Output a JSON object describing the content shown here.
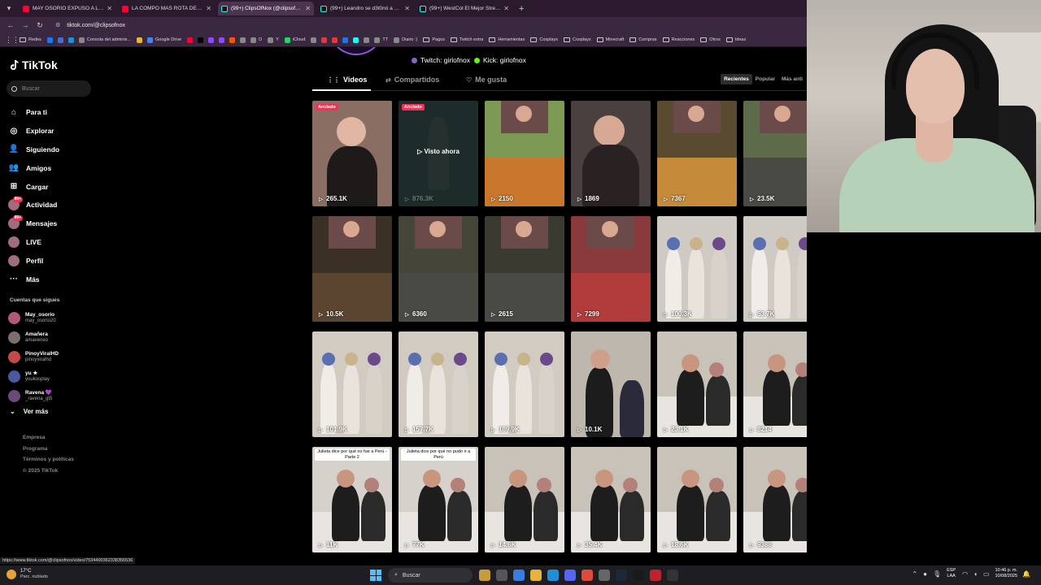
{
  "browser": {
    "tabs": [
      {
        "label": "MAY OSORIO EXPUSO A LEAN",
        "icon": "youtube-icon",
        "active": false
      },
      {
        "label": "LA COMPO MAS ROTA DEL M",
        "icon": "youtube-icon",
        "active": false
      },
      {
        "label": "(99+) ClipsOfNox (@clipsofnox)",
        "icon": "tiktok-icon",
        "active": true
      },
      {
        "label": "(99+) Leandro se d3t0nó a May",
        "icon": "tiktok-icon",
        "active": false
      },
      {
        "label": "(99+) WestCol El Mejor Stream",
        "icon": "tiktok-icon",
        "active": false
      }
    ],
    "url": "tiktok.com/@clipsofnox",
    "bookmarks": [
      "Redes",
      "",
      "",
      "",
      "Consola del adminis...",
      "",
      "Google Drive",
      "",
      "",
      "",
      "",
      "",
      "",
      "D",
      "Y",
      "iCloud",
      "",
      "",
      "",
      "",
      "",
      "",
      "TT",
      "Diario :)",
      "Pagos",
      "Twitch extra",
      "Herramientas",
      "Cosplays",
      "Cosplays",
      "Minecraft",
      "Compras",
      "Reacciones",
      "Otros",
      "Ideas"
    ]
  },
  "sidebar": {
    "logo": "TikTok",
    "search_placeholder": "Buscar",
    "nav": [
      {
        "label": "Para ti",
        "icon": "home-icon"
      },
      {
        "label": "Explorar",
        "icon": "compass-icon"
      },
      {
        "label": "Siguiendo",
        "icon": "following-icon"
      },
      {
        "label": "Amigos",
        "icon": "friends-icon"
      },
      {
        "label": "Cargar",
        "icon": "upload-icon"
      },
      {
        "label": "Actividad",
        "icon": "activity-icon",
        "badge": "99+"
      },
      {
        "label": "Mensajes",
        "icon": "messages-icon",
        "badge": "99+"
      },
      {
        "label": "LIVE",
        "icon": "live-icon"
      },
      {
        "label": "Perfil",
        "icon": "profile-icon"
      },
      {
        "label": "Más",
        "icon": "more-icon"
      }
    ],
    "following_title": "Cuentas que sigues",
    "following": [
      {
        "name": "May_osorio",
        "handle": "may_osorio20",
        "color": "#b05a78"
      },
      {
        "name": "Amañera",
        "handle": "amaveneo",
        "color": "#7a6f6a"
      },
      {
        "name": "PinoyViralHD",
        "handle": "pinoyviralhd",
        "color": "#c24a4a"
      },
      {
        "name": "yu ★",
        "handle": "yuukosplay",
        "color": "#4a5a9a"
      },
      {
        "name": "Ravena 💜",
        "handle": "_ravena_gt5",
        "color": "#6a4a7a"
      }
    ],
    "ver_mas": "Ver más",
    "footer": [
      "Empresa",
      "Programa",
      "Términos y políticas",
      "© 2025 TikTok"
    ]
  },
  "profile": {
    "twitch": "Twitch: girlofnox",
    "kick": "Kick: girlofnox",
    "tabs": [
      "Videos",
      "Compartidos",
      "Me gusta"
    ],
    "sort": [
      "Recientes",
      "Popular",
      "Más anti"
    ]
  },
  "videos": [
    {
      "views": "265.1K",
      "pinned": "Anclado",
      "bg": "#8a6e63",
      "theme": "girl"
    },
    {
      "views": "876.3K",
      "pinned": "Anclado",
      "bg": "#1d2b2a",
      "theme": "dark",
      "overlay": "Visto ahora"
    },
    {
      "views": "2150",
      "bg": "#7d9a55",
      "theme": "mc-orange"
    },
    {
      "views": "1869",
      "bg": "#4a4040",
      "theme": "girl-dark"
    },
    {
      "views": "7367",
      "bg": "#5a4a2f",
      "theme": "mc-fire"
    },
    {
      "views": "23.5K",
      "bg": "#5d6b4a",
      "theme": "mc"
    },
    {
      "views": "10.5K",
      "bg": "#3a3024",
      "theme": "mc-wood"
    },
    {
      "views": "6360",
      "bg": "#45453a",
      "theme": "mc-cave"
    },
    {
      "views": "2615",
      "bg": "#3a3a30",
      "theme": "mc-cave"
    },
    {
      "views": "7299",
      "bg": "#8a3a3a",
      "theme": "mc-red"
    },
    {
      "views": "100.3K",
      "bg": "#cfcbc4",
      "theme": "group"
    },
    {
      "views": "53.7K",
      "bg": "#cfcbc4",
      "theme": "group"
    },
    {
      "views": "101.9K",
      "bg": "#d2cbc2",
      "theme": "group"
    },
    {
      "views": "157.7K",
      "bg": "#d2cbc2",
      "theme": "group"
    },
    {
      "views": "189.9K",
      "bg": "#d2cbc2",
      "theme": "group"
    },
    {
      "views": "10.1K",
      "bg": "#bdb7ae",
      "theme": "pair"
    },
    {
      "views": "23.1K",
      "bg": "#c8c2b8",
      "theme": "sofa"
    },
    {
      "views": "8214",
      "bg": "#c8c2b8",
      "theme": "sofa"
    },
    {
      "views": "11K",
      "bg": "#d6d1cb",
      "theme": "sofa",
      "caption": "Julieta dice por qué no fue a Perú - Parte 2"
    },
    {
      "views": "77K",
      "bg": "#d6d1cb",
      "theme": "sofa",
      "caption": "Julieta dice por qué no pudo ir a Perú"
    },
    {
      "views": "14.6K",
      "bg": "#c8c2b8",
      "theme": "sofa"
    },
    {
      "views": "35.4K",
      "bg": "#c8c2b8",
      "theme": "sofa"
    },
    {
      "views": "18.6K",
      "bg": "#c8c2b8",
      "theme": "sofa"
    },
    {
      "views": "9388",
      "bg": "#c8c2b8",
      "theme": "sofa"
    }
  ],
  "statusbar_link": "https://www.tiktok.com/@clipsofnox/video/7534400362338356536",
  "taskbar": {
    "weather_temp": "17°C",
    "weather_desc": "Parc. nublado",
    "search": "Buscar",
    "lang1": "ESP",
    "lang2": "LAA",
    "time": "10:46 p. m.",
    "date": "10/08/2025"
  }
}
